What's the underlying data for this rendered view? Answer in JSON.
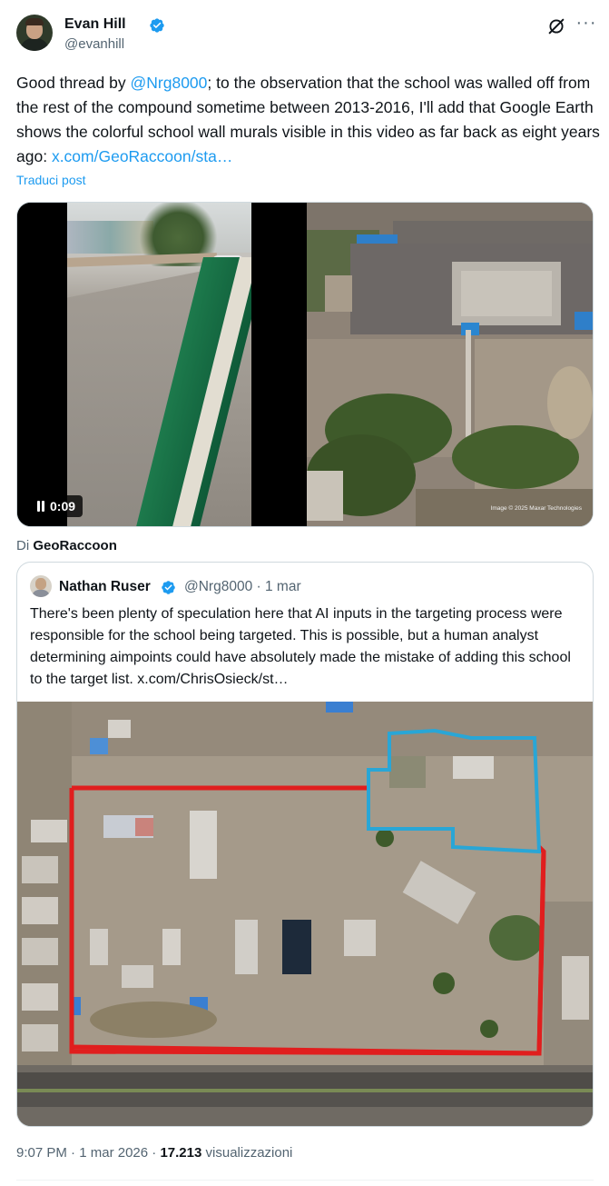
{
  "author": {
    "name": "Evan Hill",
    "handle": "@evanhill",
    "verified": true
  },
  "actions": {
    "grok_icon": "grok-icon",
    "more_icon": "more-icon",
    "more_label": "···"
  },
  "tweet": {
    "text_part1": "Good thread by ",
    "mention": "@Nrg8000",
    "text_part2": "; to the observation that the school was walled off from the rest of the compound sometime between 2013-2016, I'll add that Google Earth shows the colorful school wall murals visible in this video as far back as eight years ago: ",
    "link": "x.com/GeoRaccoon/sta…",
    "translate": "Traduci post"
  },
  "media": {
    "video_duration": "0:09",
    "pause_icon": "pause-icon",
    "image_credit": "Image © 2025 Maxar Technologies"
  },
  "attribution": {
    "prefix": "Di",
    "source": "GeoRaccoon"
  },
  "quoted": {
    "name": "Nathan Ruser",
    "handle": "@Nrg8000",
    "date": "1 mar",
    "verified": true,
    "text": "There's been plenty of speculation here that AI inputs in the targeting process were responsible for the school being targeted. This is possible, but a human analyst determining aimpoints could have absolutely made the mistake of adding this school to the target list.  x.com/ChrisOsieck/st…",
    "map_outline_colors": {
      "school": "#29a6d6",
      "compound": "#e01e1e"
    }
  },
  "footer": {
    "time": "9:07 PM",
    "date": "1 mar 2026",
    "views": "17.213",
    "views_label": "visualizzazioni"
  },
  "colors": {
    "link": "#1d9bf0",
    "secondary_text": "#536471",
    "primary_text": "#0f1419",
    "border": "#cfd9de"
  }
}
